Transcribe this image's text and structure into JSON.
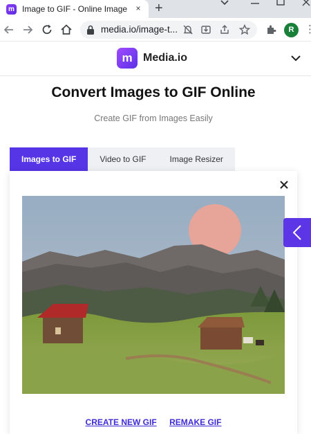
{
  "browser": {
    "tab_title": "Image to GIF - Online Images to",
    "favicon_letter": "m",
    "tab_close": "×",
    "new_tab": "+",
    "url": "media.io/image-t...",
    "profile_letter": "R"
  },
  "site": {
    "logo_letter": "m",
    "brand_name": "Media.io"
  },
  "hero": {
    "title": "Convert Images to GIF Online",
    "subtitle": "Create GIF from Images Easily"
  },
  "tools": {
    "tabs": [
      {
        "label": "Images to GIF",
        "active": true
      },
      {
        "label": "Video to GIF",
        "active": false
      },
      {
        "label": "Image Resizer",
        "active": false
      }
    ]
  },
  "result": {
    "preview_alt": "mountain landscape with houses",
    "actions": {
      "create_new": "CREATE NEW GIF",
      "remake": "REMAKE GIF"
    }
  },
  "colors": {
    "accent": "#5535e6",
    "link": "#3d2bd6"
  }
}
